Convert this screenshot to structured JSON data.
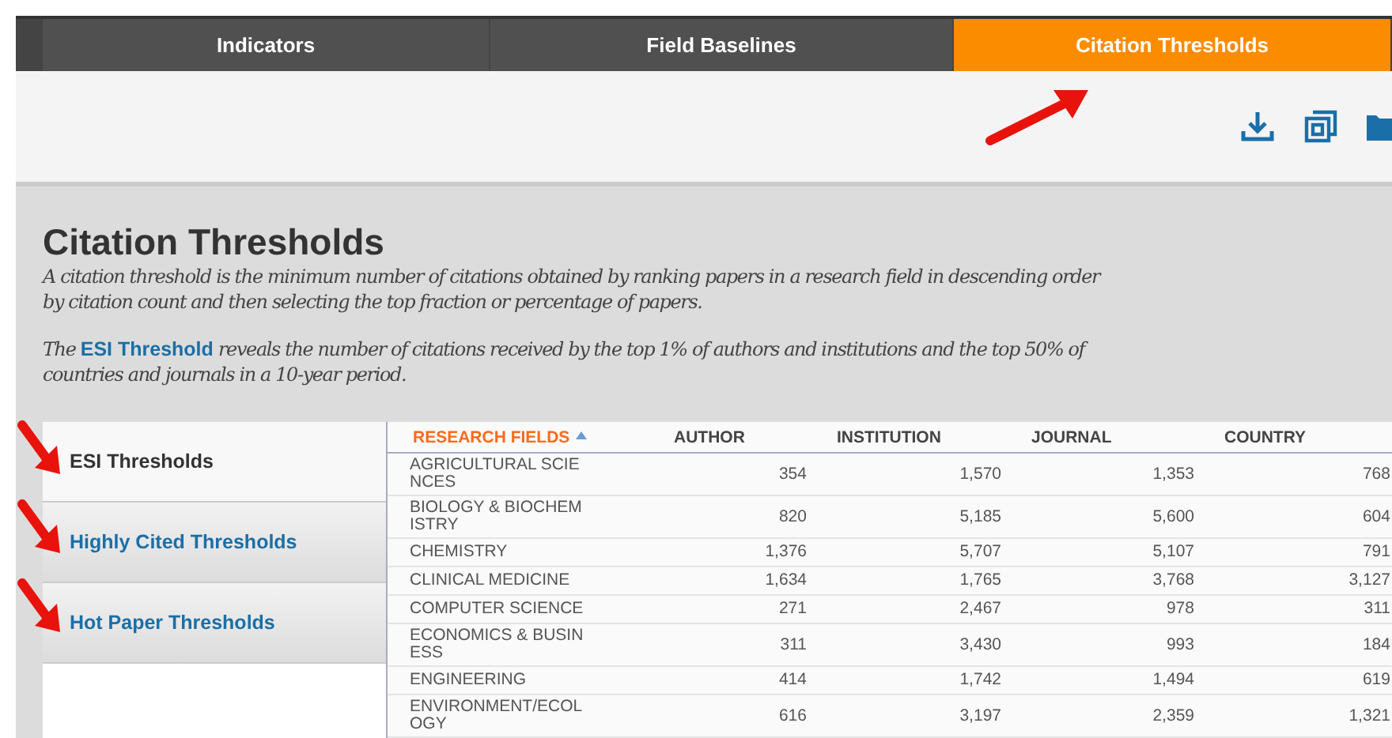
{
  "tabs": [
    {
      "label": "Indicators",
      "selected": false
    },
    {
      "label": "Field Baselines",
      "selected": false
    },
    {
      "label": "Citation Thresholds",
      "selected": true
    }
  ],
  "heading": {
    "title": "Citation Thresholds",
    "description": "A citation threshold is the minimum number of citations obtained by ranking papers in a research field in descending order by citation count and then selecting the top fraction or percentage of papers.",
    "note_before": "The",
    "note_link": "ESI Threshold",
    "note_after": "reveals the number of citations received by the top 1% of authors and institutions and the top 50% of countries and journals in a 10-year period."
  },
  "sidebar": {
    "items": [
      {
        "label": "ESI Thresholds",
        "selected": true
      },
      {
        "label": "Highly Cited Thresholds",
        "selected": false
      },
      {
        "label": "Hot Paper Thresholds",
        "selected": false
      }
    ]
  },
  "table": {
    "columns": [
      {
        "label": "RESEARCH FIELDS",
        "sorted": true
      },
      {
        "label": "AUTHOR",
        "sorted": false
      },
      {
        "label": "INSTITUTION",
        "sorted": false
      },
      {
        "label": "JOURNAL",
        "sorted": false
      },
      {
        "label": "COUNTRY",
        "sorted": false
      }
    ],
    "rows": [
      [
        "AGRICULTURAL SCIENCES",
        "354",
        "1,570",
        "1,353",
        "768"
      ],
      [
        "BIOLOGY & BIOCHEMISTRY",
        "820",
        "5,185",
        "5,600",
        "604"
      ],
      [
        "CHEMISTRY",
        "1,376",
        "5,707",
        "5,107",
        "791"
      ],
      [
        "CLINICAL MEDICINE",
        "1,634",
        "1,765",
        "3,768",
        "3,127"
      ],
      [
        "COMPUTER SCIENCE",
        "271",
        "2,467",
        "978",
        "311"
      ],
      [
        "ECONOMICS & BUSINESS",
        "311",
        "3,430",
        "993",
        "184"
      ],
      [
        "ENGINEERING",
        "414",
        "1,742",
        "1,494",
        "619"
      ],
      [
        "ENVIRONMENT/ECOLOGY",
        "616",
        "3,197",
        "2,359",
        "1,321"
      ]
    ]
  }
}
